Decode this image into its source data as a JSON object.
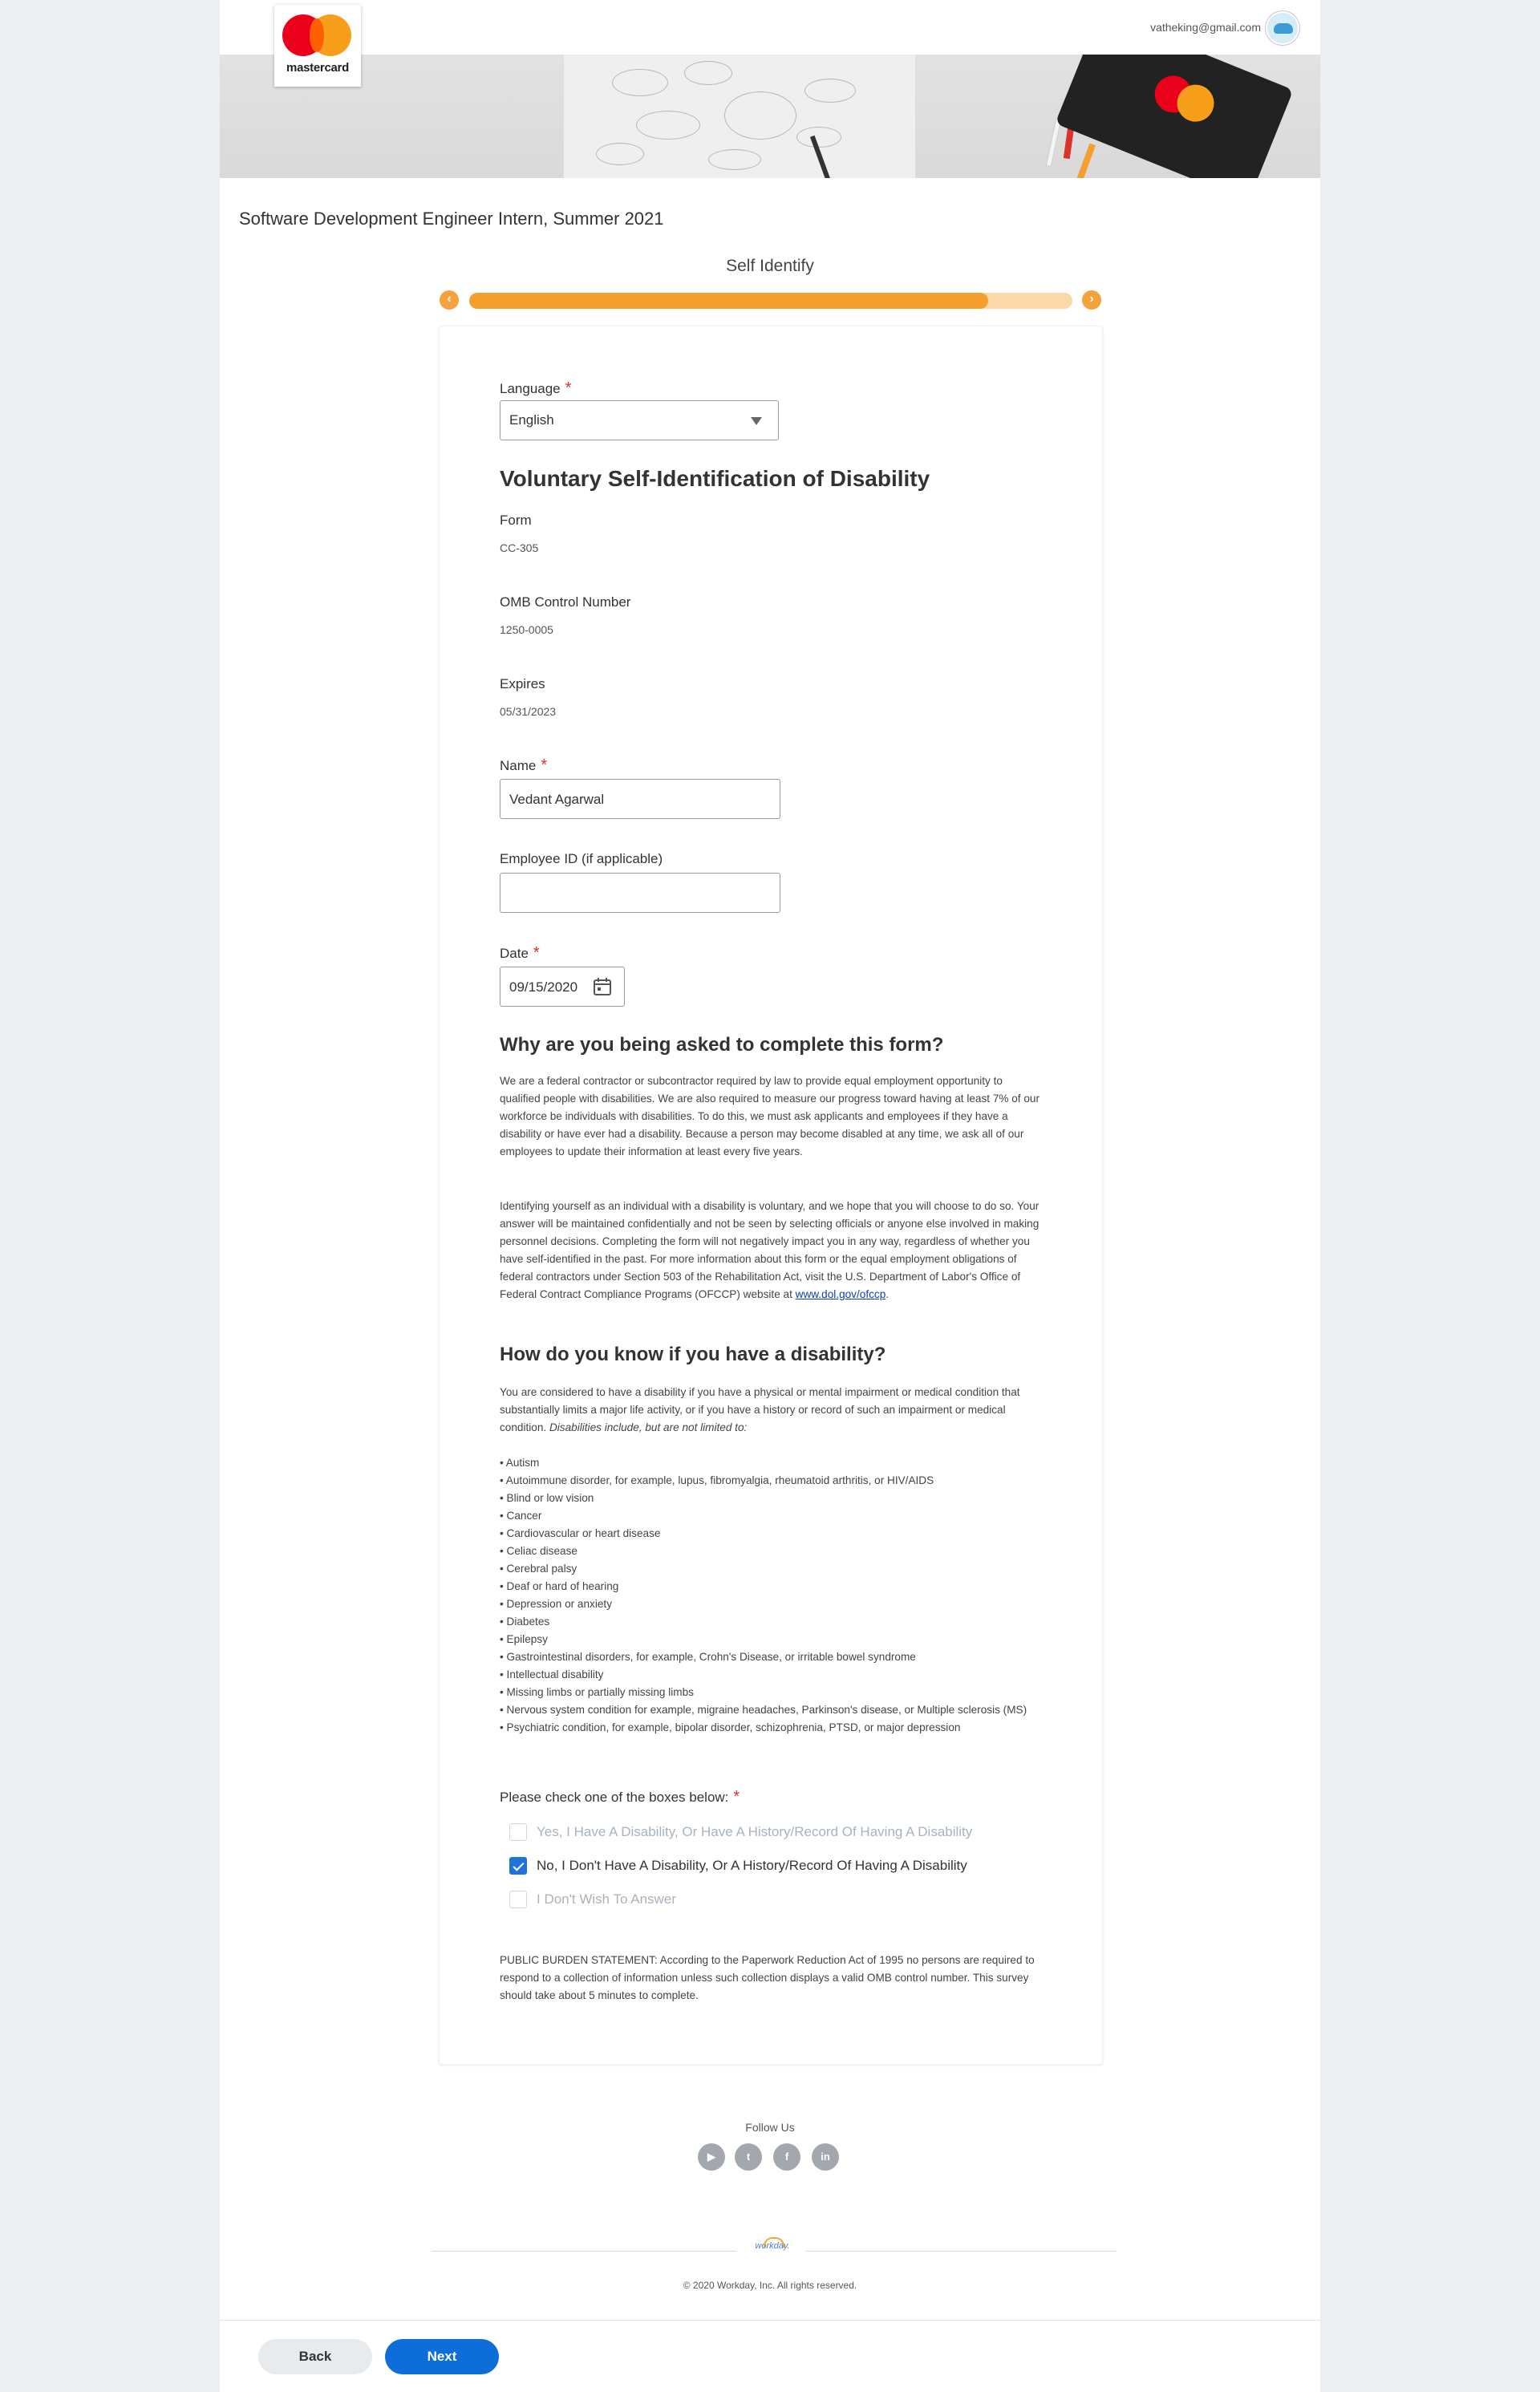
{
  "header": {
    "logo_text": "mastercard",
    "user_email": "vatheking@gmail.com"
  },
  "job_title": "Software Development Engineer Intern, Summer 2021",
  "progress": {
    "step_label": "Self Identify",
    "prev_icon": "chevron-left-icon",
    "next_icon": "chevron-right-icon",
    "fill_fraction": 0.86,
    "colors": {
      "fill": "#f59f2f",
      "track": "#fbd8a8"
    }
  },
  "form": {
    "language": {
      "label": "Language",
      "required_mark": "*",
      "value": "English"
    },
    "title": "Voluntary Self-Identification of Disability",
    "form_id": {
      "label": "Form",
      "value": "CC-305"
    },
    "omb": {
      "label": "OMB Control Number",
      "value": "1250-0005"
    },
    "expires": {
      "label": "Expires",
      "value": "05/31/2023"
    },
    "name": {
      "label": "Name",
      "required_mark": "*",
      "value": "Vedant Agarwal"
    },
    "employee_id": {
      "label": "Employee ID (if applicable)",
      "value": ""
    },
    "date": {
      "label": "Date",
      "required_mark": "*",
      "value": "09/15/2020",
      "icon": "calendar-icon"
    },
    "why": {
      "heading": "Why are you being asked to complete this form?",
      "p1": "We are a federal contractor or subcontractor required by law to provide equal employment opportunity to qualified people with disabilities.  We are also required to measure our progress toward having at least 7% of our workforce be individuals with disabilities.  To do this, we must ask applicants and employees if they have a disability or have ever had a disability.  Because a person may become disabled at any time, we ask all of our employees to update their information at least every five years.",
      "p2": "Identifying yourself as an individual with a disability is voluntary, and we hope that you will choose to do so.  Your answer will be maintained confidentially and not be seen by selecting officials or anyone else involved in making personnel decisions.  Completing the form will not negatively impact you in any way, regardless of whether you have self-identified in the past.  For more information about this form or the equal employment obligations of federal contractors under Section 503 of the Rehabilitation Act, visit the U.S. Department of Labor's Office of Federal Contract Compliance Programs (OFCCP) website at ",
      "link": "www.dol.gov/ofccp",
      "p2_end": "."
    },
    "how": {
      "heading": "How do you know if you have a disability?",
      "p1": "You are considered to have a disability if you have a physical or mental impairment or medical condition that substantially limits a major life activity, or if you have a history or record of such an impairment or medical condition. ",
      "p1_italic": "Disabilities include, but are not limited to:",
      "items": [
        "• Autism",
        "• Autoimmune disorder, for example, lupus, fibromyalgia, rheumatoid arthritis, or HIV/AIDS",
        "• Blind or low vision",
        "• Cancer",
        "• Cardiovascular or heart disease",
        "• Celiac disease",
        "• Cerebral palsy",
        "• Deaf or hard of hearing",
        "• Depression or anxiety",
        "• Diabetes",
        "• Epilepsy",
        "• Gastrointestinal disorders, for example, Crohn's Disease, or irritable bowel syndrome",
        "• Intellectual disability",
        "• Missing limbs or partially missing limbs",
        "• Nervous system condition for example, migraine headaches, Parkinson's disease, or Multiple sclerosis (MS)",
        "• Psychiatric condition, for example, bipolar disorder, schizophrenia, PTSD, or major depression"
      ]
    },
    "check": {
      "label": "Please check one of the boxes below:",
      "required_mark": "*",
      "options": [
        {
          "label": "Yes, I Have A Disability, Or Have A History/Record Of Having A Disability",
          "checked": false
        },
        {
          "label": "No, I Don't Have A Disability, Or A History/Record Of Having A Disability",
          "checked": true
        },
        {
          "label": "I Don't Wish To Answer",
          "checked": false
        }
      ]
    },
    "burden": "PUBLIC BURDEN STATEMENT:  According to the Paperwork Reduction Act of 1995 no persons are required to respond to a collection of information unless such collection displays a valid OMB control number. This survey should take about 5 minutes to complete."
  },
  "footer": {
    "follow_label": "Follow Us",
    "social": [
      {
        "name": "youtube-icon",
        "glyph": "▶"
      },
      {
        "name": "twitter-icon",
        "glyph": "t"
      },
      {
        "name": "facebook-icon",
        "glyph": "f"
      },
      {
        "name": "linkedin-icon",
        "glyph": "in"
      }
    ],
    "brand": "workday.",
    "copyright": "© 2020 Workday, Inc. All rights reserved."
  },
  "actions": {
    "back": "Back",
    "next": "Next"
  },
  "colors": {
    "primary_button": "#0d6ed9",
    "required": "#d9332b",
    "accent": "#f59f2f"
  }
}
